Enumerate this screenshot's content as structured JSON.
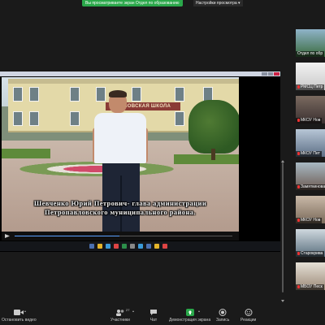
{
  "top": {
    "share_banner": "Вы просматриваете экран Отдел по образованию",
    "view_options": "Настройки просмотра"
  },
  "shared_video": {
    "school_sign": "...ВЛОВСКАЯ ШКОЛА",
    "caption": "Шевченко Юрий Петрович- глава администрации Петропавловского муниципального района.",
    "progress": 0.48
  },
  "participants": [
    {
      "name": "Отдел по обр",
      "active": true,
      "colors": [
        "#8fb3c9",
        "#3a6b3e"
      ]
    },
    {
      "name": "РМСЦ Петр",
      "muted": true,
      "colors": [
        "#f2f2f2",
        "#c9c9c9"
      ]
    },
    {
      "name": "МКОУ Нов",
      "muted": true,
      "colors": [
        "#7a6a60",
        "#3a3030"
      ]
    },
    {
      "name": "МКОУ Пет",
      "muted": true,
      "colors": [
        "#b7c6d6",
        "#5d6f86"
      ]
    },
    {
      "name": "Замяткиновая",
      "muted": true,
      "colors": [
        "#a8b9c3",
        "#6c5a52"
      ]
    },
    {
      "name": "МКОУ Нов",
      "muted": true,
      "colors": [
        "#c9b9a8",
        "#7a6a5a"
      ]
    },
    {
      "name": "Старокрива",
      "muted": true,
      "colors": [
        "#cfd8de",
        "#5a6f7e"
      ]
    },
    {
      "name": "МБОУ Песк",
      "muted": true,
      "colors": [
        "#e5e0d6",
        "#9c8a78"
      ]
    }
  ],
  "toolbar": {
    "video_label": "Остановить видео",
    "participants_label": "Участники",
    "participants_count": "27",
    "chat_label": "Чат",
    "share_label": "Демонстрация экрана",
    "record_label": "Запись",
    "reactions_label": "Реакции"
  },
  "colors": {
    "accent_green": "#2aa84a",
    "active_outline": "#3ccb5a",
    "muted_red": "#e33"
  }
}
